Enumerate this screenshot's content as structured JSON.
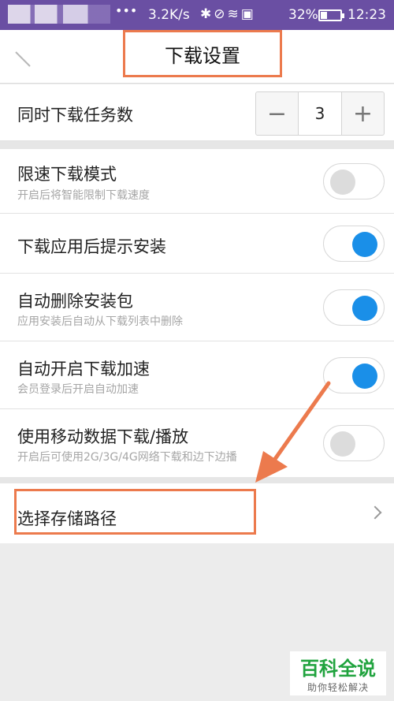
{
  "status_bar": {
    "dots": "•••",
    "speed": "3.2K/s",
    "icons": "✱⊘≋▣",
    "battery": "32%",
    "time": "12:23"
  },
  "header": {
    "title": "下载设置"
  },
  "settings": {
    "concurrent": {
      "label": "同时下载任务数",
      "value": "3",
      "minus": "−",
      "plus": "+"
    },
    "speed_limit": {
      "label": "限速下载模式",
      "sub": "开启后将智能限制下载速度",
      "on": false
    },
    "install_prompt": {
      "label": "下载应用后提示安装",
      "on": true
    },
    "auto_delete": {
      "label": "自动删除安装包",
      "sub": "应用安装后自动从下载列表中删除",
      "on": true
    },
    "auto_boost": {
      "label": "自动开启下载加速",
      "sub": "会员登录后开启自动加速",
      "on": true
    },
    "mobile_data": {
      "label": "使用移动数据下载/播放",
      "sub": "开启后可使用2G/3G/4G网络下载和边下边播",
      "on": false
    },
    "storage_path": {
      "label": "选择存储路径"
    }
  },
  "watermark": {
    "main": "百科全说",
    "sub": "助你轻松解决"
  },
  "colors": {
    "status_bar": "#6a4fa3",
    "toggle_on": "#1a8fe8",
    "highlight": "#ec7a4d"
  }
}
